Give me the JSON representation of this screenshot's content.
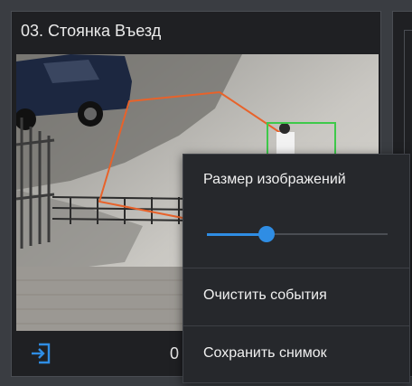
{
  "camera": {
    "title": "03. Стоянка Въезд",
    "event_counter": "0"
  },
  "icons": {
    "exit": "exit-entrance-icon"
  },
  "colors": {
    "zone_outline": "#e8622a",
    "detection_box": "#3ec94a",
    "accent": "#2f8de4",
    "background": "#1f2023"
  },
  "context_menu": {
    "image_size_label": "Размер изображений",
    "image_size_slider_value": 0.33,
    "clear_events_label": "Очистить события",
    "save_snapshot_label": "Сохранить снимок"
  }
}
